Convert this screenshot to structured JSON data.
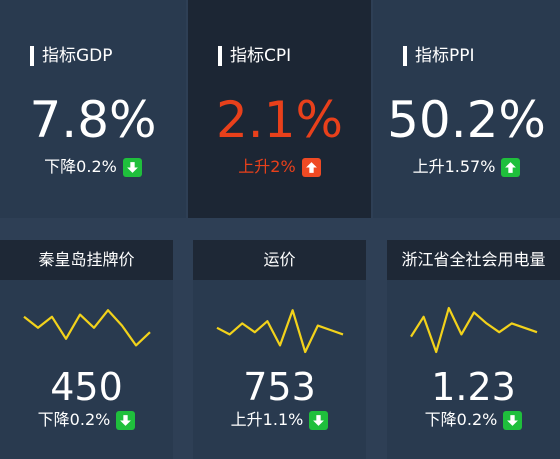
{
  "top_cards": [
    {
      "title": "指标GDP",
      "value": "7.8%",
      "change": "下降0.2%",
      "direction": "down-arrow-icon"
    },
    {
      "title": "指标CPI",
      "value": "2.1%",
      "change": "上升2%",
      "direction": "up-arrow-icon"
    },
    {
      "title": "指标PPI",
      "value": "50.2%",
      "change": "上升1.57%",
      "direction": "up-arrow-icon"
    }
  ],
  "bottom_cards": [
    {
      "title": "秦皇岛挂牌价",
      "value": "450",
      "change": "下降0.2%",
      "direction": "down-arrow-icon",
      "trend": [
        0.2,
        0.45,
        0.2,
        0.7,
        0.15,
        0.45,
        0.05,
        0.4,
        0.85,
        0.55
      ]
    },
    {
      "title": "运价",
      "value": "753",
      "change": "上升1.1%",
      "direction": "down-arrow-icon",
      "trend": [
        0.45,
        0.6,
        0.35,
        0.55,
        0.3,
        0.85,
        0.05,
        1.0,
        0.4,
        0.5,
        0.6
      ]
    },
    {
      "title": "浙江省全社会用电量",
      "value": "1.23",
      "change": "下降0.2%",
      "direction": "down-arrow-icon",
      "trend": [
        0.65,
        0.2,
        1.0,
        0.0,
        0.6,
        0.1,
        0.35,
        0.55,
        0.35,
        0.45,
        0.55
      ]
    }
  ],
  "colors": {
    "background": "#2e3f55",
    "card": "#293a4f",
    "card_highlight": "#1c2634",
    "header": "#1e2836",
    "accent_red": "#e8401b",
    "down_green": "#1fbf3c",
    "up_orange": "#ef4a24",
    "sparkline": "#f2d21b"
  }
}
